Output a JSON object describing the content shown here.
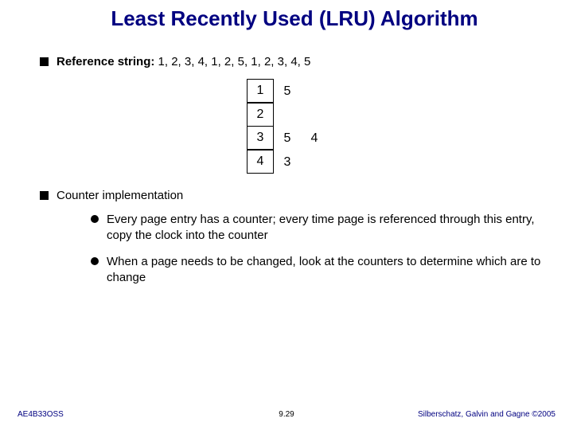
{
  "title": "Least Recently Used (LRU) Algorithm",
  "ref_string_label": "Reference string:",
  "ref_string_value": "  1, 2, 3, 4, 1, 2, 5, 1, 2, 3, 4, 5",
  "frames": {
    "r1c1": "1",
    "r1c2": "5",
    "r2c1": "2",
    "r3c1": "3",
    "r3c2": "5",
    "r3c3": "4",
    "r4c1": "4",
    "r4c2": "3"
  },
  "counter_impl": "Counter implementation",
  "sub1": "Every page entry has a counter; every time page is referenced through this entry, copy the clock into the counter",
  "sub2": "When a page needs to be changed, look at the counters to determine which are to change",
  "footer_left": "AE4B33OSS",
  "footer_center": "9.29",
  "footer_right": "Silberschatz, Galvin and Gagne ©2005"
}
